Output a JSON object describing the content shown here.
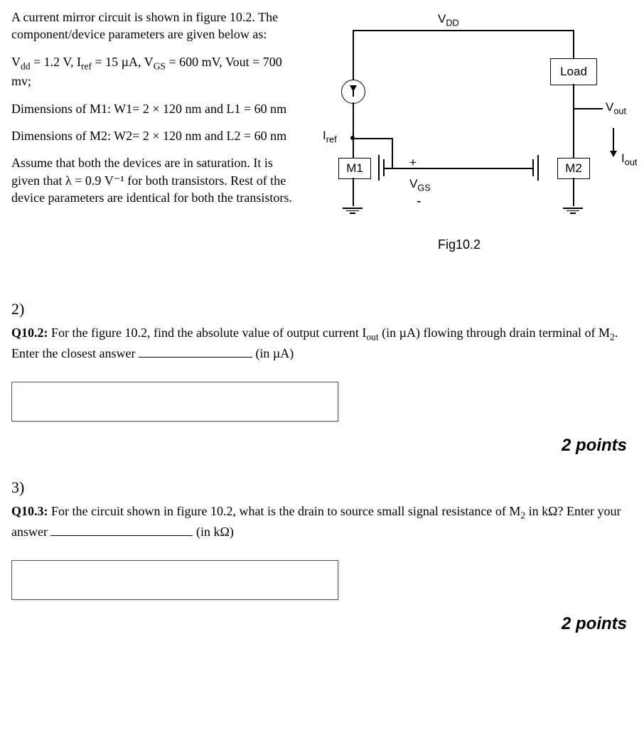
{
  "problem": {
    "intro": "A current mirror circuit is shown in figure 10.2. The component/device parameters are given below as:",
    "params": "Vdd = 1.2 V, Iref = 15 µA, VGS = 600 mV, Vout = 700 mv;",
    "dim_m1": "Dimensions of M1:   W1= 2 × 120 nm and L1 = 60 nm",
    "dim_m2": "Dimensions of M2:   W2= 2 × 120 nm and L2 = 60 nm",
    "assume": "Assume that both the devices are in saturation. It is given that λ = 0.9 V⁻¹ for both transistors. Rest of the device parameters are identical for both the transistors."
  },
  "diagram": {
    "vdd": "V",
    "vdd_sub": "DD",
    "load": "Load",
    "iref": "I",
    "iref_sub": "ref",
    "m1": "M1",
    "m2": "M2",
    "vgs": "V",
    "vgs_sub": "GS",
    "plus": "+",
    "minus": "-",
    "vout": "V",
    "vout_sub": "out",
    "iout": "I",
    "iout_sub": "out",
    "caption": "Fig10.2"
  },
  "q2": {
    "num": "2)",
    "label": "Q10.2:",
    "text_a": " For the figure 10.2, find the absolute value of output current I",
    "text_a_sub": "out",
    "text_b": " (in µA) flowing through drain terminal of M",
    "text_b_sub": "2",
    "text_c": ". Enter the closest answer ",
    "unit": " (in µA)",
    "points": "2 points"
  },
  "q3": {
    "num": "3)",
    "label": "Q10.3:",
    "text_a": " For the circuit shown in figure 10.2, what is the drain to source small signal resistance of M",
    "text_a_sub": "2",
    "text_b": " in kΩ? Enter your answer ",
    "unit": " (in kΩ)",
    "points": "2 points"
  }
}
